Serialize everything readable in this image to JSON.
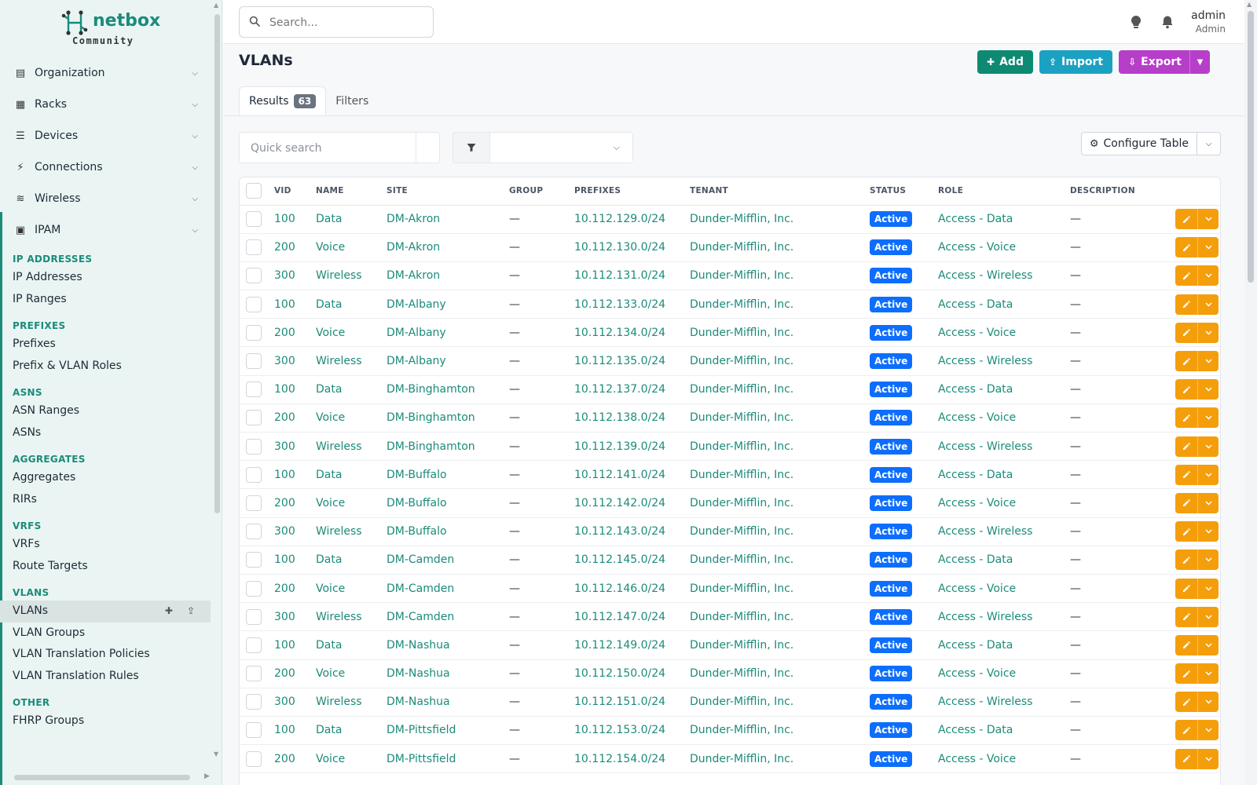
{
  "brand": {
    "name": "netbox",
    "edition": "Community"
  },
  "nav": [
    {
      "label": "Organization",
      "icon": "building-icon",
      "glyph": "▤"
    },
    {
      "label": "Racks",
      "icon": "rack-icon",
      "glyph": "▦"
    },
    {
      "label": "Devices",
      "icon": "server-icon",
      "glyph": "☰"
    },
    {
      "label": "Connections",
      "icon": "plug-icon",
      "glyph": "⚡"
    },
    {
      "label": "Wireless",
      "icon": "wifi-icon",
      "glyph": "≋"
    },
    {
      "label": "IPAM",
      "icon": "ipam-icon",
      "glyph": "▣"
    }
  ],
  "submenu": [
    {
      "heading": "IP ADDRESSES",
      "items": [
        "IP Addresses",
        "IP Ranges"
      ]
    },
    {
      "heading": "PREFIXES",
      "items": [
        "Prefixes",
        "Prefix & VLAN Roles"
      ]
    },
    {
      "heading": "ASNS",
      "items": [
        "ASN Ranges",
        "ASNs"
      ]
    },
    {
      "heading": "AGGREGATES",
      "items": [
        "Aggregates",
        "RIRs"
      ]
    },
    {
      "heading": "VRFS",
      "items": [
        "VRFs",
        "Route Targets"
      ]
    },
    {
      "heading": "VLANS",
      "items": [
        "VLANs",
        "VLAN Groups",
        "VLAN Translation Policies",
        "VLAN Translation Rules"
      ]
    },
    {
      "heading": "OTHER",
      "items": [
        "FHRP Groups"
      ]
    }
  ],
  "active_item": "VLANs",
  "search": {
    "placeholder": "Search..."
  },
  "user": {
    "name": "admin",
    "role": "Admin"
  },
  "page": {
    "title": "VLANs"
  },
  "buttons": {
    "add": "Add",
    "import": "Import",
    "export": "Export"
  },
  "tabs": {
    "results": "Results",
    "results_count": "63",
    "filters": "Filters"
  },
  "quick_search": {
    "placeholder": "Quick search"
  },
  "configure_table": "Configure Table",
  "colors": {
    "accent": "#1b8b7a",
    "status_active": "#0d6efd",
    "action": "#f59e0b"
  },
  "table": {
    "columns": [
      "VID",
      "NAME",
      "SITE",
      "GROUP",
      "PREFIXES",
      "TENANT",
      "STATUS",
      "ROLE",
      "DESCRIPTION"
    ],
    "rows": [
      [
        "100",
        "Data",
        "DM-Akron",
        "—",
        "10.112.129.0/24",
        "Dunder-Mifflin, Inc.",
        "Active",
        "Access - Data",
        "—"
      ],
      [
        "200",
        "Voice",
        "DM-Akron",
        "—",
        "10.112.130.0/24",
        "Dunder-Mifflin, Inc.",
        "Active",
        "Access - Voice",
        "—"
      ],
      [
        "300",
        "Wireless",
        "DM-Akron",
        "—",
        "10.112.131.0/24",
        "Dunder-Mifflin, Inc.",
        "Active",
        "Access - Wireless",
        "—"
      ],
      [
        "100",
        "Data",
        "DM-Albany",
        "—",
        "10.112.133.0/24",
        "Dunder-Mifflin, Inc.",
        "Active",
        "Access - Data",
        "—"
      ],
      [
        "200",
        "Voice",
        "DM-Albany",
        "—",
        "10.112.134.0/24",
        "Dunder-Mifflin, Inc.",
        "Active",
        "Access - Voice",
        "—"
      ],
      [
        "300",
        "Wireless",
        "DM-Albany",
        "—",
        "10.112.135.0/24",
        "Dunder-Mifflin, Inc.",
        "Active",
        "Access - Wireless",
        "—"
      ],
      [
        "100",
        "Data",
        "DM-Binghamton",
        "—",
        "10.112.137.0/24",
        "Dunder-Mifflin, Inc.",
        "Active",
        "Access - Data",
        "—"
      ],
      [
        "200",
        "Voice",
        "DM-Binghamton",
        "—",
        "10.112.138.0/24",
        "Dunder-Mifflin, Inc.",
        "Active",
        "Access - Voice",
        "—"
      ],
      [
        "300",
        "Wireless",
        "DM-Binghamton",
        "—",
        "10.112.139.0/24",
        "Dunder-Mifflin, Inc.",
        "Active",
        "Access - Wireless",
        "—"
      ],
      [
        "100",
        "Data",
        "DM-Buffalo",
        "—",
        "10.112.141.0/24",
        "Dunder-Mifflin, Inc.",
        "Active",
        "Access - Data",
        "—"
      ],
      [
        "200",
        "Voice",
        "DM-Buffalo",
        "—",
        "10.112.142.0/24",
        "Dunder-Mifflin, Inc.",
        "Active",
        "Access - Voice",
        "—"
      ],
      [
        "300",
        "Wireless",
        "DM-Buffalo",
        "—",
        "10.112.143.0/24",
        "Dunder-Mifflin, Inc.",
        "Active",
        "Access - Wireless",
        "—"
      ],
      [
        "100",
        "Data",
        "DM-Camden",
        "—",
        "10.112.145.0/24",
        "Dunder-Mifflin, Inc.",
        "Active",
        "Access - Data",
        "—"
      ],
      [
        "200",
        "Voice",
        "DM-Camden",
        "—",
        "10.112.146.0/24",
        "Dunder-Mifflin, Inc.",
        "Active",
        "Access - Voice",
        "—"
      ],
      [
        "300",
        "Wireless",
        "DM-Camden",
        "—",
        "10.112.147.0/24",
        "Dunder-Mifflin, Inc.",
        "Active",
        "Access - Wireless",
        "—"
      ],
      [
        "100",
        "Data",
        "DM-Nashua",
        "—",
        "10.112.149.0/24",
        "Dunder-Mifflin, Inc.",
        "Active",
        "Access - Data",
        "—"
      ],
      [
        "200",
        "Voice",
        "DM-Nashua",
        "—",
        "10.112.150.0/24",
        "Dunder-Mifflin, Inc.",
        "Active",
        "Access - Voice",
        "—"
      ],
      [
        "300",
        "Wireless",
        "DM-Nashua",
        "—",
        "10.112.151.0/24",
        "Dunder-Mifflin, Inc.",
        "Active",
        "Access - Wireless",
        "—"
      ],
      [
        "100",
        "Data",
        "DM-Pittsfield",
        "—",
        "10.112.153.0/24",
        "Dunder-Mifflin, Inc.",
        "Active",
        "Access - Data",
        "—"
      ],
      [
        "200",
        "Voice",
        "DM-Pittsfield",
        "—",
        "10.112.154.0/24",
        "Dunder-Mifflin, Inc.",
        "Active",
        "Access - Voice",
        "—"
      ]
    ]
  }
}
